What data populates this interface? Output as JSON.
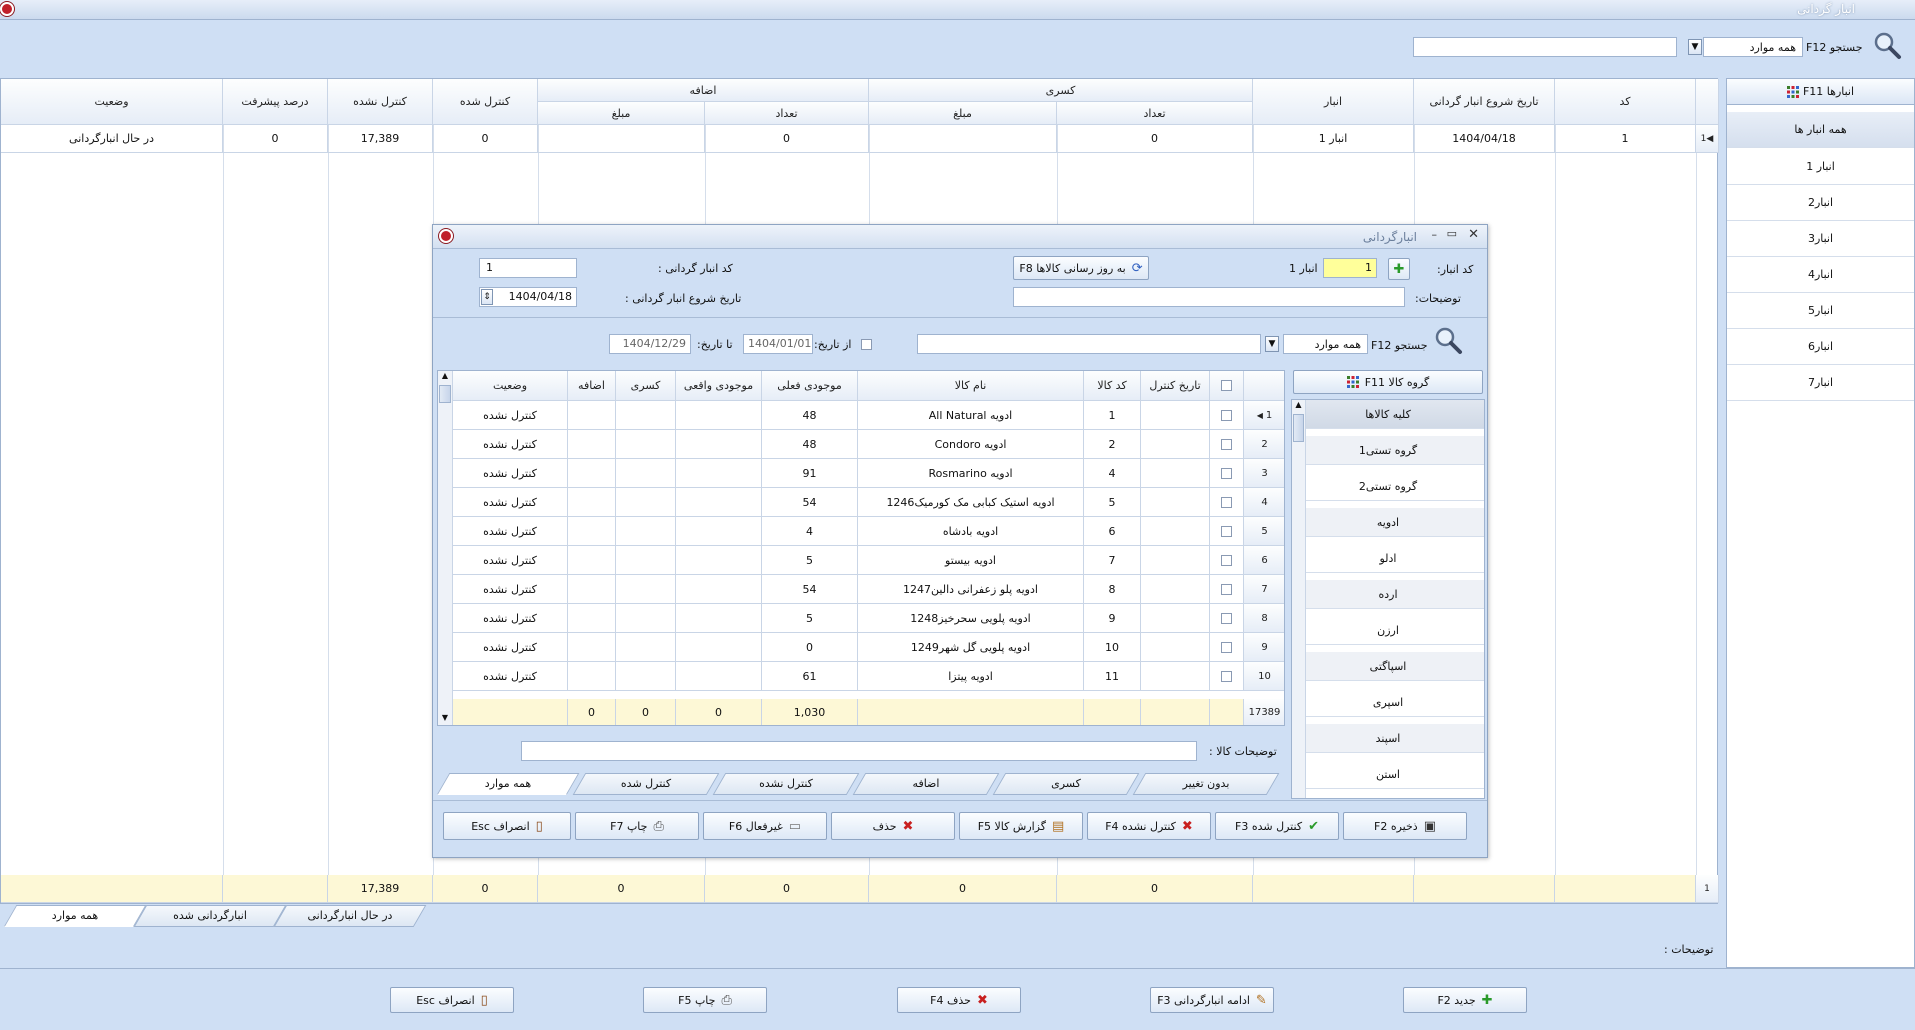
{
  "window": {
    "title": "انبار گردانی"
  },
  "search": {
    "label": "جستجو F12",
    "filter_value": "همه موارد",
    "value": ""
  },
  "sidebar": {
    "header": "انبارها F11",
    "items": [
      "همه انبار ها",
      "انبار 1",
      "انبار2",
      "انبار3",
      "انبار4",
      "انبار5",
      "انبار6",
      "انبار7"
    ]
  },
  "main_table": {
    "headers": {
      "code": "کد",
      "start_date": "تاریخ شروع انبار گردانی",
      "warehouse": "انبار",
      "deficit": "کسری",
      "surplus": "اضافه",
      "count": "تعداد",
      "amount": "مبلغ",
      "controlled": "کنترل شده",
      "not_controlled": "کنترل نشده",
      "progress": "درصد پیشرفت",
      "status": "وضعیت"
    },
    "rows": [
      {
        "index": "1",
        "code": "1",
        "start_date": "1404/04/18",
        "warehouse": "انبار 1",
        "deficit_count": "0",
        "deficit_amount": "",
        "surplus_count": "0",
        "surplus_amount": "",
        "controlled": "0",
        "not_controlled": "17,389",
        "progress": "0",
        "status": "در حال انبارگردانی"
      }
    ],
    "footer": {
      "index": "1",
      "deficit_count": "0",
      "deficit_amount": "0",
      "surplus_count": "0",
      "surplus_amount": "0",
      "controlled": "0",
      "not_controlled": "17,389"
    }
  },
  "main_tabs": [
    "در حال انبارگردانی",
    "انبارگردانی شده",
    "همه موارد"
  ],
  "description_label": "توضیحات :",
  "bottom_buttons": {
    "new": "جدید F2",
    "continue": "ادامه انبارگردانی F3",
    "delete": "حذف F4",
    "print": "چاپ F5",
    "cancel": "انصراف Esc"
  },
  "dialog": {
    "title": "انبارگردانی",
    "warehouse_code_label": "کد انبار:",
    "warehouse_code_value": "1",
    "warehouse_name": "انبار 1",
    "update_button": "به روز رسانی کالاها F8",
    "count_code_label": "کد انبار گردانی :",
    "count_code_value": "1",
    "description_label": "توضیحات:",
    "start_date_label": "تاریخ شروع انبار گردانی :",
    "start_date_value": "1404/04/18",
    "search_label": "جستجو F12",
    "search_filter": "همه موارد",
    "from_date_label": "از تاریخ:",
    "from_date_value": "1404/01/01",
    "to_date_label": "تا تاریخ:",
    "to_date_value": "1404/12/29",
    "group_header": "گروه کالا F11",
    "groups": [
      "کلیه کالاها",
      "گروه تستی1",
      "گروه تستی2",
      "ادویه",
      "ادلو",
      "ارده",
      "ارزن",
      "اسپاگتی",
      "اسپری",
      "اسپند",
      "استن"
    ],
    "item_headers": {
      "control_date": "تاریخ کنترل",
      "item_code": "کد کالا",
      "item_name": "نام کالا",
      "current_stock": "موجودی فعلی",
      "actual_stock": "موجودی واقعی",
      "deficit": "کسری",
      "surplus": "اضافه",
      "status": "وضعیت"
    },
    "items": [
      {
        "i": "1",
        "code": "1",
        "name": "ادویه All Natural",
        "stock": "48",
        "status": "کنترل نشده"
      },
      {
        "i": "2",
        "code": "2",
        "name": "ادویه Condoro",
        "stock": "48",
        "status": "کنترل نشده"
      },
      {
        "i": "3",
        "code": "4",
        "name": "ادویه Rosmarino",
        "stock": "91",
        "status": "کنترل نشده"
      },
      {
        "i": "4",
        "code": "5",
        "name": "ادویه استیک کبابی مک کورمیک1246",
        "stock": "54",
        "status": "کنترل نشده"
      },
      {
        "i": "5",
        "code": "6",
        "name": "ادویه بادشاه",
        "stock": "4",
        "status": "کنترل نشده"
      },
      {
        "i": "6",
        "code": "7",
        "name": "ادویه بیستو",
        "stock": "5",
        "status": "کنترل نشده"
      },
      {
        "i": "7",
        "code": "8",
        "name": "ادویه پلو زعفرانی دالین1247",
        "stock": "54",
        "status": "کنترل نشده"
      },
      {
        "i": "8",
        "code": "9",
        "name": "ادویه پلویی سحرخیز1248",
        "stock": "5",
        "status": "کنترل نشده"
      },
      {
        "i": "9",
        "code": "10",
        "name": "ادویه پلویی گل شهر1249",
        "stock": "0",
        "status": "کنترل نشده"
      },
      {
        "i": "10",
        "code": "11",
        "name": "ادویه پیتزا",
        "stock": "61",
        "status": "کنترل نشده"
      }
    ],
    "footer": {
      "count": "17389",
      "stock": "1,030",
      "actual": "0",
      "deficit": "0",
      "surplus": "0"
    },
    "item_desc_label": "توضیحات کالا :",
    "tabs": [
      "بدون تغییر",
      "کسری",
      "اضافه",
      "کنترل نشده",
      "کنترل شده",
      "همه موارد"
    ],
    "buttons": {
      "save": "ذخیره F2",
      "controlled": "کنترل شده F3",
      "not_controlled": "کنترل نشده F4",
      "report": "گزارش کالا F5",
      "delete": "حذف",
      "deactivate": "غیرفعال F6",
      "print": "چاپ F7",
      "cancel": "انصراف Esc"
    }
  }
}
